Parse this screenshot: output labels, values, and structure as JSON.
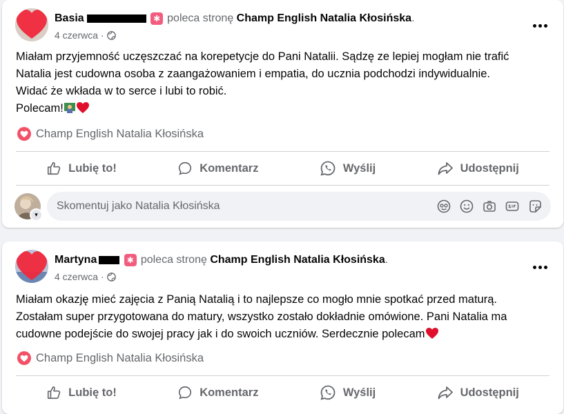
{
  "posts": [
    {
      "author": "Basia",
      "verb": "poleca stronę",
      "page": "Champ English Natalia Kłosińska",
      "punct": ".",
      "date": "4 czerwca",
      "date_sep": "·",
      "text_lines": [
        "Miałam  przyjemność uczęszczać na korepetycje do Pani Natalii. Sądzę ze lepiej mogłam nie trafić",
        "Natalia jest cudowna osoba z zaangażowaniem i empatia, do ucznia podchodzi indywidualnie.",
        "Widać że wkłada w to serce i lubi to robić.",
        "Polecam!"
      ],
      "rec_page": "Champ English Natalia Kłosińska",
      "actions": {
        "like": "Lubię to!",
        "comment": "Komentarz",
        "send": "Wyślij",
        "share": "Udostępnij"
      },
      "comment_placeholder": "Skomentuj jako Natalia Kłosińska"
    },
    {
      "author": "Martyna",
      "verb": "poleca stronę",
      "page": "Champ English Natalia Kłosińska",
      "punct": ".",
      "date": "4 czerwca",
      "date_sep": "·",
      "text_lines": [
        "Miałam okazję mieć zajęcia z Panią Natalią i to najlepsze co mogło mnie spotkać przed maturą.",
        "Zostałam super przygotowana do matury, wszystko zostało dokładnie omówione. Pani Natalia ma",
        "cudowne podejście do swojej pracy jak i do swoich uczniów. Serdecznie polecam"
      ],
      "rec_page": "Champ English Natalia Kłosińska",
      "actions": {
        "like": "Lubię to!",
        "comment": "Komentarz",
        "send": "Wyślij",
        "share": "Udostępnij"
      }
    }
  ],
  "icons": {
    "heart_color": "#f0283c",
    "rec_heart_color": "#f25268",
    "badge_color": "#f25c7f",
    "muted_text": "#65676b"
  }
}
